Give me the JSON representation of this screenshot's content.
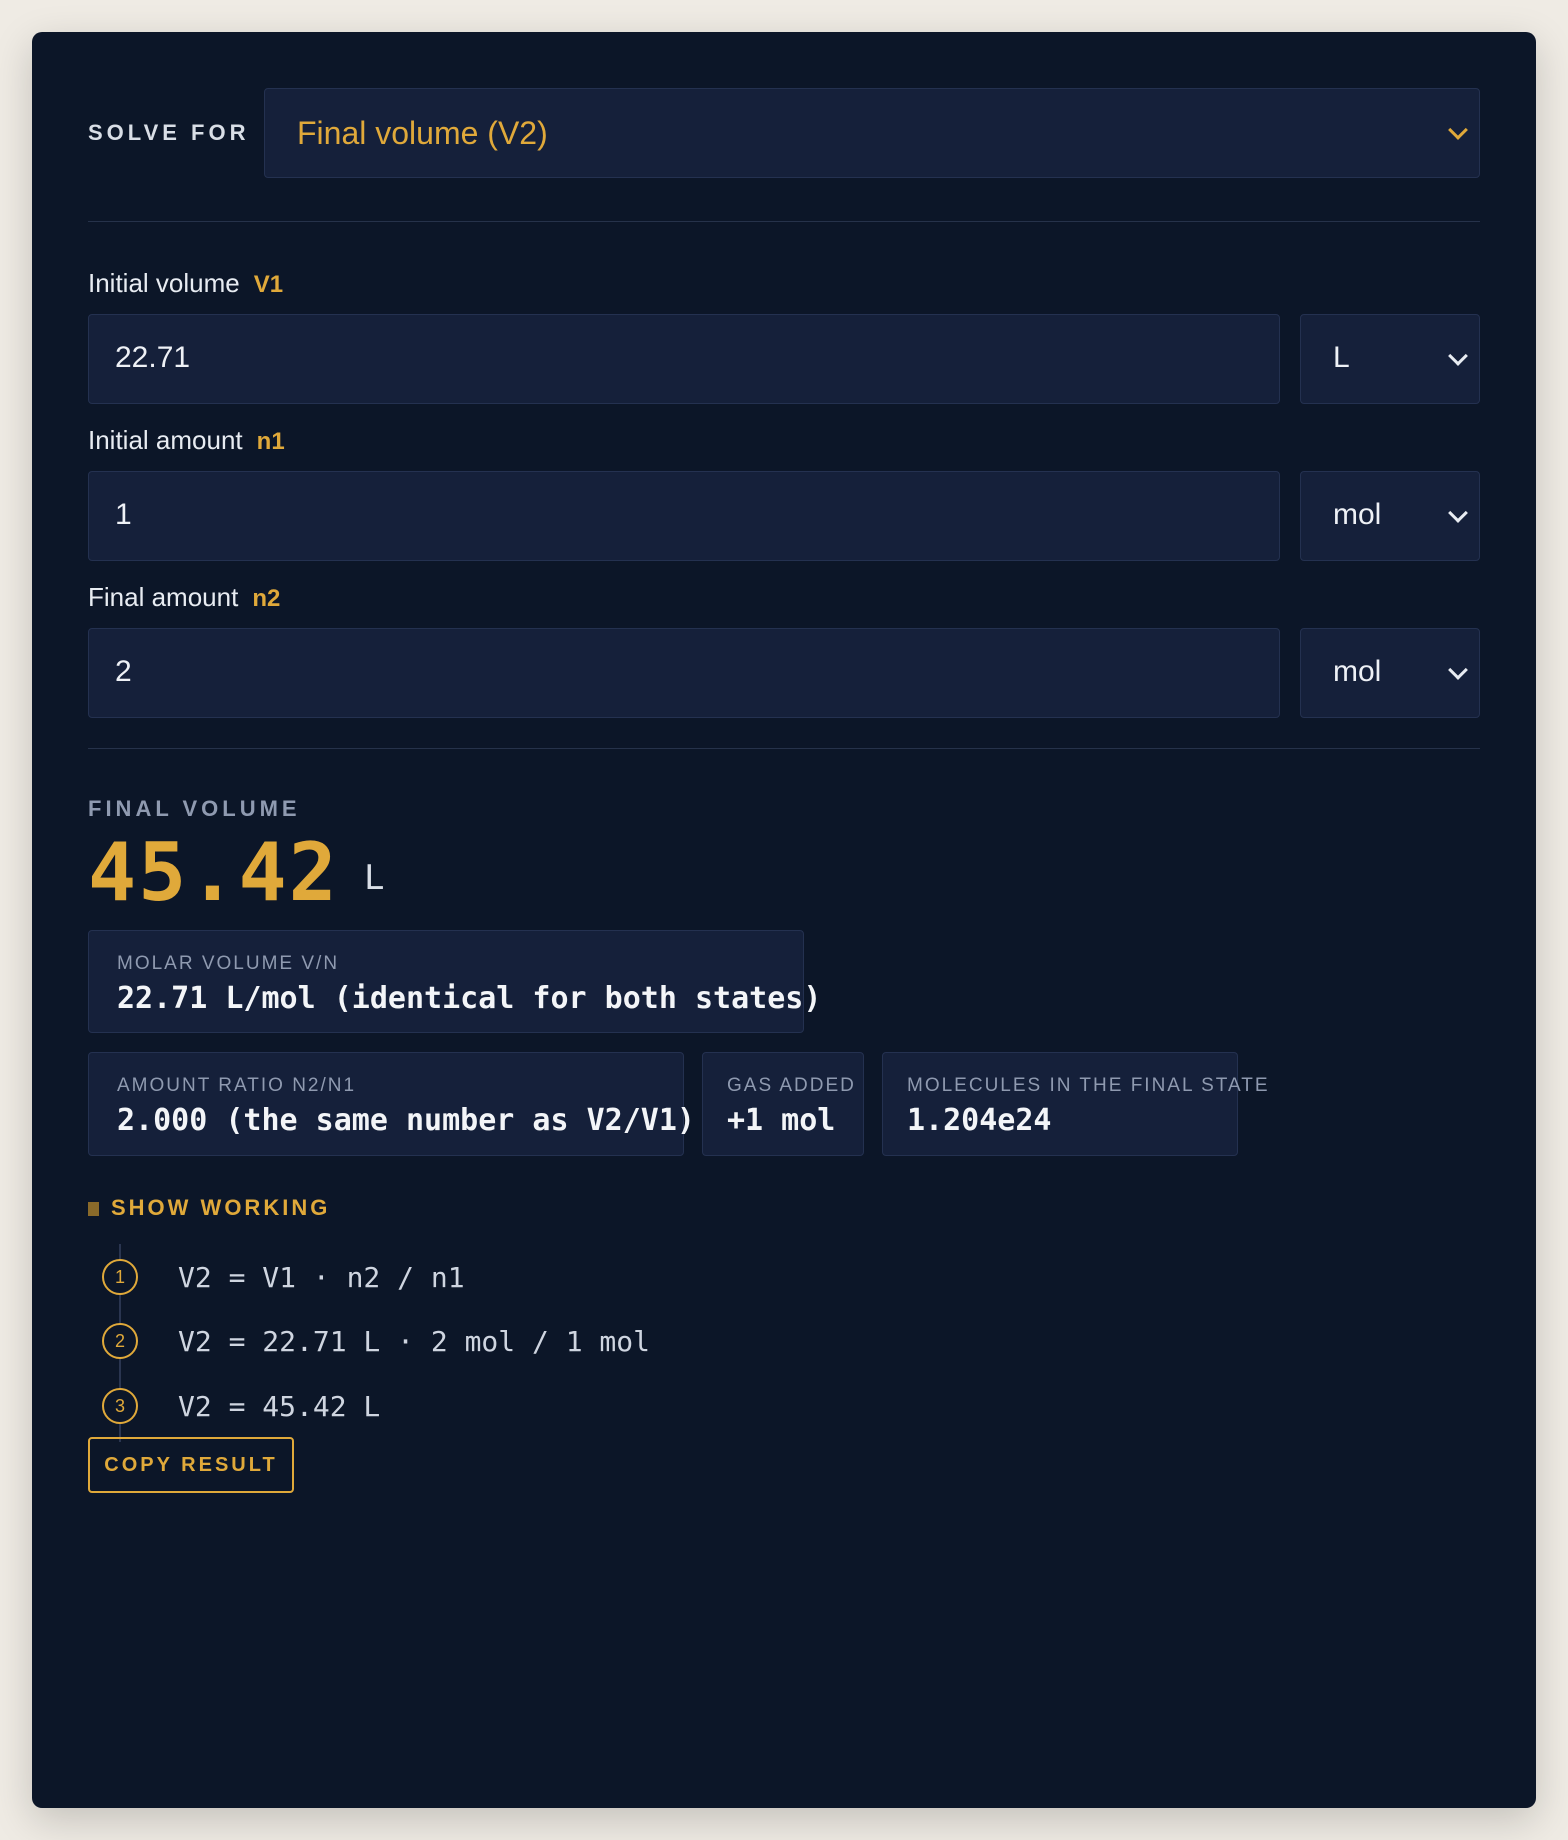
{
  "solve_for": {
    "label": "SOLVE FOR",
    "selected": "Final volume (V2)"
  },
  "fields": [
    {
      "label": "Initial volume",
      "symbol": "V1",
      "value": "22.71",
      "unit": "L"
    },
    {
      "label": "Initial amount",
      "symbol": "n1",
      "value": "1",
      "unit": "mol"
    },
    {
      "label": "Final amount",
      "symbol": "n2",
      "value": "2",
      "unit": "mol"
    }
  ],
  "result": {
    "label": "FINAL VOLUME",
    "value": "45.42",
    "unit": "L"
  },
  "cards": {
    "molar_volume": {
      "label": "MOLAR VOLUME V/N",
      "value": "22.71 L/mol (identical for both states)"
    },
    "amount_ratio": {
      "label": "AMOUNT RATIO N2/N1",
      "value": "2.000 (the same number as V2/V1)"
    },
    "gas_added": {
      "label": "GAS ADDED",
      "value": "+1 mol"
    },
    "molecules": {
      "label": "MOLECULES IN THE FINAL STATE",
      "value": "1.204e24"
    }
  },
  "working": {
    "toggle_label": "SHOW WORKING",
    "steps": [
      {
        "num": "1",
        "text": "V2 = V1 · n2 / n1"
      },
      {
        "num": "2",
        "text": "V2 = 22.71 L · 2 mol / 1 mol"
      },
      {
        "num": "3",
        "text": "V2 = 45.42 L"
      }
    ]
  },
  "copy_button": "COPY RESULT",
  "colors": {
    "accent": "#e0a93a",
    "panel_bg": "#0c1628",
    "field_bg": "#15203a"
  }
}
